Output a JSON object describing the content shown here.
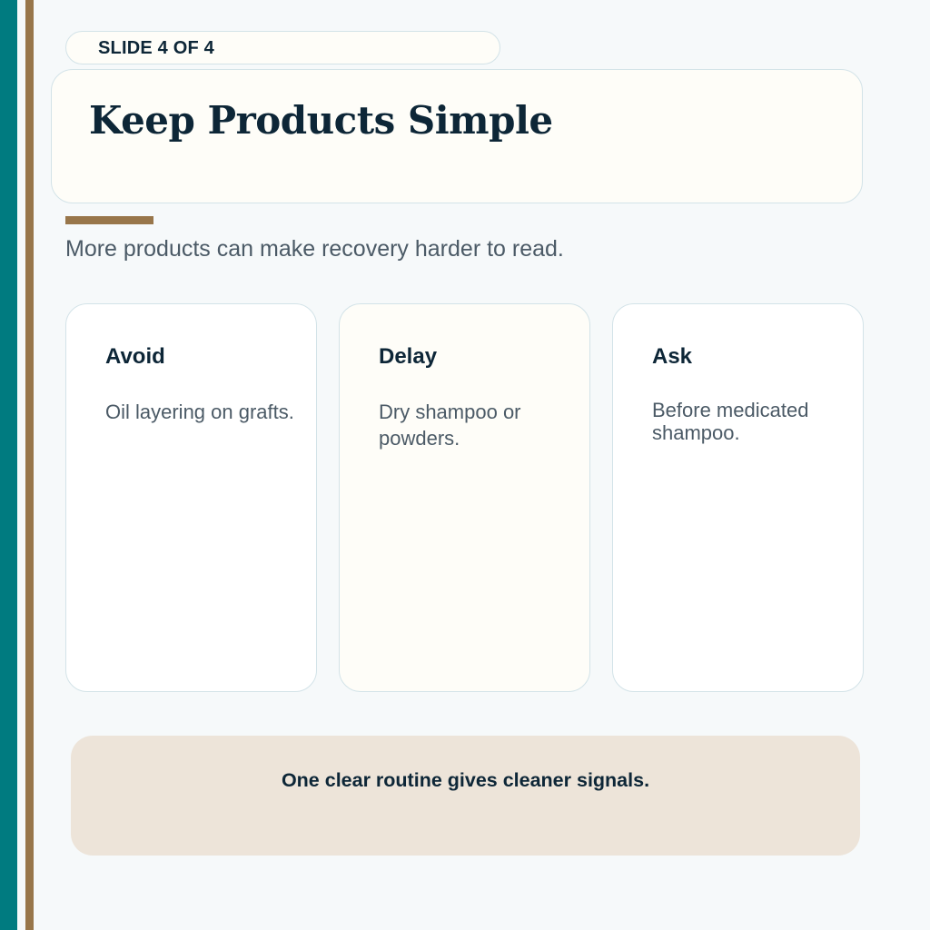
{
  "slide": {
    "counter": "SLIDE 4 OF 4",
    "title": "Keep Products Simple",
    "subtitle": "More products can make recovery harder to read."
  },
  "cards": [
    {
      "heading": "Avoid",
      "body": "Oil layering on grafts."
    },
    {
      "heading": "Delay",
      "body": "Dry shampoo or powders."
    },
    {
      "heading": "Ask",
      "body": "Before medicated shampoo."
    }
  ],
  "banner": {
    "text": "One clear routine gives cleaner signals."
  },
  "colors": {
    "teal": "#007b80",
    "gold": "#98764a",
    "navy": "#0d2637",
    "cream": "#fefdf8",
    "banner_bg": "#ede4d9"
  }
}
